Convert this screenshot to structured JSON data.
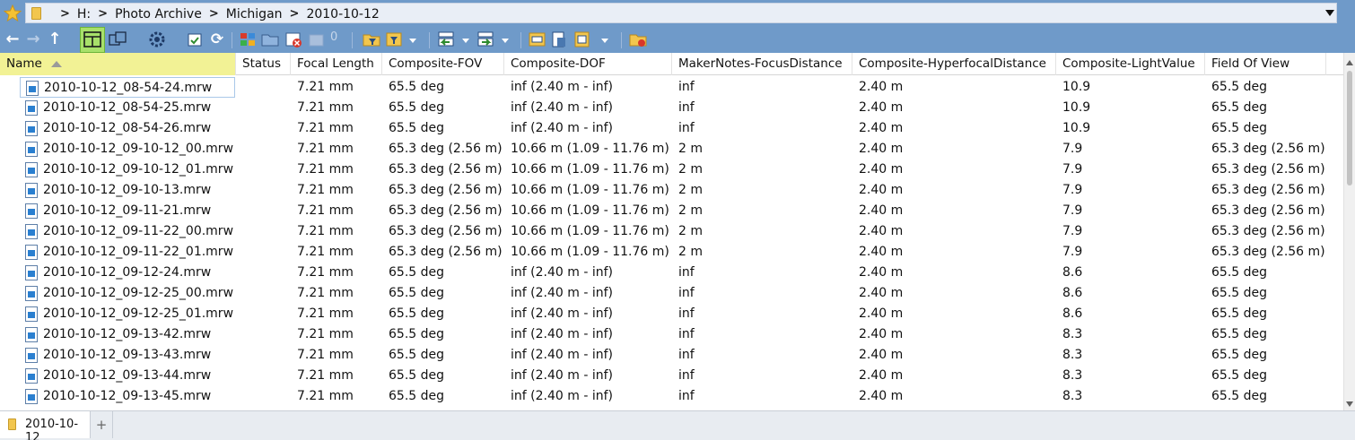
{
  "address_bar": {
    "breadcrumbs": [
      "H:",
      "Photo Archive",
      "Michigan",
      "2010-10-12"
    ],
    "separator": ">"
  },
  "toolbar": {
    "back_icon": "arrow-left",
    "forward_icon": "arrow-right",
    "up_icon": "arrow-up",
    "counter_value": "0",
    "accent_active": "#a8e06a"
  },
  "columns": [
    {
      "key": "name",
      "label": "Name",
      "sorted": "ascending"
    },
    {
      "key": "status",
      "label": "Status"
    },
    {
      "key": "focal",
      "label": "Focal Length"
    },
    {
      "key": "fov",
      "label": "Composite-FOV"
    },
    {
      "key": "dof",
      "label": "Composite-DOF"
    },
    {
      "key": "focus",
      "label": "MakerNotes-FocusDistance"
    },
    {
      "key": "hyper",
      "label": "Composite-HyperfocalDistance"
    },
    {
      "key": "lv",
      "label": "Composite-LightValue"
    },
    {
      "key": "fieldofview",
      "label": "Field Of View"
    }
  ],
  "rows": [
    {
      "name": "2010-10-12_08-54-24.mrw",
      "status": "",
      "focal": "7.21 mm",
      "fov": "65.5 deg",
      "dof": "inf (2.40 m - inf)",
      "focus": "inf",
      "hyper": "2.40 m",
      "lv": "10.9",
      "fieldofview": "65.5 deg"
    },
    {
      "name": "2010-10-12_08-54-25.mrw",
      "status": "",
      "focal": "7.21 mm",
      "fov": "65.5 deg",
      "dof": "inf (2.40 m - inf)",
      "focus": "inf",
      "hyper": "2.40 m",
      "lv": "10.9",
      "fieldofview": "65.5 deg"
    },
    {
      "name": "2010-10-12_08-54-26.mrw",
      "status": "",
      "focal": "7.21 mm",
      "fov": "65.5 deg",
      "dof": "inf (2.40 m - inf)",
      "focus": "inf",
      "hyper": "2.40 m",
      "lv": "10.9",
      "fieldofview": "65.5 deg"
    },
    {
      "name": "2010-10-12_09-10-12_00.mrw",
      "status": "",
      "focal": "7.21 mm",
      "fov": "65.3 deg (2.56 m)",
      "dof": "10.66 m (1.09 - 11.76 m)",
      "focus": "2 m",
      "hyper": "2.40 m",
      "lv": "7.9",
      "fieldofview": "65.3 deg (2.56 m)"
    },
    {
      "name": "2010-10-12_09-10-12_01.mrw",
      "status": "",
      "focal": "7.21 mm",
      "fov": "65.3 deg (2.56 m)",
      "dof": "10.66 m (1.09 - 11.76 m)",
      "focus": "2 m",
      "hyper": "2.40 m",
      "lv": "7.9",
      "fieldofview": "65.3 deg (2.56 m)"
    },
    {
      "name": "2010-10-12_09-10-13.mrw",
      "status": "",
      "focal": "7.21 mm",
      "fov": "65.3 deg (2.56 m)",
      "dof": "10.66 m (1.09 - 11.76 m)",
      "focus": "2 m",
      "hyper": "2.40 m",
      "lv": "7.9",
      "fieldofview": "65.3 deg (2.56 m)"
    },
    {
      "name": "2010-10-12_09-11-21.mrw",
      "status": "",
      "focal": "7.21 mm",
      "fov": "65.3 deg (2.56 m)",
      "dof": "10.66 m (1.09 - 11.76 m)",
      "focus": "2 m",
      "hyper": "2.40 m",
      "lv": "7.9",
      "fieldofview": "65.3 deg (2.56 m)"
    },
    {
      "name": "2010-10-12_09-11-22_00.mrw",
      "status": "",
      "focal": "7.21 mm",
      "fov": "65.3 deg (2.56 m)",
      "dof": "10.66 m (1.09 - 11.76 m)",
      "focus": "2 m",
      "hyper": "2.40 m",
      "lv": "7.9",
      "fieldofview": "65.3 deg (2.56 m)"
    },
    {
      "name": "2010-10-12_09-11-22_01.mrw",
      "status": "",
      "focal": "7.21 mm",
      "fov": "65.3 deg (2.56 m)",
      "dof": "10.66 m (1.09 - 11.76 m)",
      "focus": "2 m",
      "hyper": "2.40 m",
      "lv": "7.9",
      "fieldofview": "65.3 deg (2.56 m)"
    },
    {
      "name": "2010-10-12_09-12-24.mrw",
      "status": "",
      "focal": "7.21 mm",
      "fov": "65.5 deg",
      "dof": "inf (2.40 m - inf)",
      "focus": "inf",
      "hyper": "2.40 m",
      "lv": "8.6",
      "fieldofview": "65.5 deg"
    },
    {
      "name": "2010-10-12_09-12-25_00.mrw",
      "status": "",
      "focal": "7.21 mm",
      "fov": "65.5 deg",
      "dof": "inf (2.40 m - inf)",
      "focus": "inf",
      "hyper": "2.40 m",
      "lv": "8.6",
      "fieldofview": "65.5 deg"
    },
    {
      "name": "2010-10-12_09-12-25_01.mrw",
      "status": "",
      "focal": "7.21 mm",
      "fov": "65.5 deg",
      "dof": "inf (2.40 m - inf)",
      "focus": "inf",
      "hyper": "2.40 m",
      "lv": "8.6",
      "fieldofview": "65.5 deg"
    },
    {
      "name": "2010-10-12_09-13-42.mrw",
      "status": "",
      "focal": "7.21 mm",
      "fov": "65.5 deg",
      "dof": "inf (2.40 m - inf)",
      "focus": "inf",
      "hyper": "2.40 m",
      "lv": "8.3",
      "fieldofview": "65.5 deg"
    },
    {
      "name": "2010-10-12_09-13-43.mrw",
      "status": "",
      "focal": "7.21 mm",
      "fov": "65.5 deg",
      "dof": "inf (2.40 m - inf)",
      "focus": "inf",
      "hyper": "2.40 m",
      "lv": "8.3",
      "fieldofview": "65.5 deg"
    },
    {
      "name": "2010-10-12_09-13-44.mrw",
      "status": "",
      "focal": "7.21 mm",
      "fov": "65.5 deg",
      "dof": "inf (2.40 m - inf)",
      "focus": "inf",
      "hyper": "2.40 m",
      "lv": "8.3",
      "fieldofview": "65.5 deg"
    },
    {
      "name": "2010-10-12_09-13-45.mrw",
      "status": "",
      "focal": "7.21 mm",
      "fov": "65.5 deg",
      "dof": "inf (2.40 m - inf)",
      "focus": "inf",
      "hyper": "2.40 m",
      "lv": "8.3",
      "fieldofview": "65.5 deg"
    }
  ],
  "tabs": [
    {
      "label": "2010-10-12",
      "active": true
    }
  ],
  "tab_add_label": "+",
  "colors": {
    "chrome_blue": "#6f9ac9",
    "sorted_header": "#f2f295",
    "folder_yellow": "#f2c64e"
  }
}
